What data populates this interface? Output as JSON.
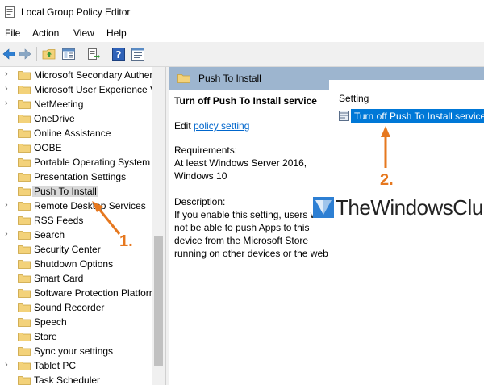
{
  "window": {
    "title": "Local Group Policy Editor"
  },
  "menu": [
    "File",
    "Action",
    "View",
    "Help"
  ],
  "tree": {
    "items": [
      {
        "label": "Microsoft Secondary Authen",
        "expandable": true
      },
      {
        "label": "Microsoft User Experience V",
        "expandable": true
      },
      {
        "label": "NetMeeting",
        "expandable": true
      },
      {
        "label": "OneDrive",
        "expandable": false
      },
      {
        "label": "Online Assistance",
        "expandable": false
      },
      {
        "label": "OOBE",
        "expandable": false
      },
      {
        "label": "Portable Operating System",
        "expandable": false
      },
      {
        "label": "Presentation Settings",
        "expandable": false
      },
      {
        "label": "Push To Install",
        "expandable": false,
        "selected": true
      },
      {
        "label": "Remote Desktop Services",
        "expandable": true
      },
      {
        "label": "RSS Feeds",
        "expandable": false
      },
      {
        "label": "Search",
        "expandable": true
      },
      {
        "label": "Security Center",
        "expandable": false
      },
      {
        "label": "Shutdown Options",
        "expandable": false
      },
      {
        "label": "Smart Card",
        "expandable": false
      },
      {
        "label": "Software Protection Platforn",
        "expandable": false
      },
      {
        "label": "Sound Recorder",
        "expandable": false
      },
      {
        "label": "Speech",
        "expandable": false
      },
      {
        "label": "Store",
        "expandable": false
      },
      {
        "label": "Sync your settings",
        "expandable": false
      },
      {
        "label": "Tablet PC",
        "expandable": true
      },
      {
        "label": "Task Scheduler",
        "expandable": false
      }
    ]
  },
  "panel": {
    "header": "Push To Install",
    "title": "Turn off Push To Install service",
    "edit_prefix": "Edit",
    "edit_link": "policy setting",
    "requirements_label": "Requirements:",
    "requirements_lines": [
      "At least Windows Server 2016,",
      "Windows 10"
    ],
    "description_label": "Description:",
    "description_lines": [
      "If you enable this setting, users w",
      "not be able to push Apps to this",
      "device from the Microsoft Store",
      "running on other devices or the web"
    ]
  },
  "list": {
    "column": "Setting",
    "row": "Turn off Push To Install service"
  },
  "watermark": {
    "text": "TheWindowsClub"
  },
  "annotations": {
    "step1": "1.",
    "step2": "2.",
    "color": "#e6781f"
  },
  "colors": {
    "header_bg": "#9db5cf",
    "selection_bg": "#0078d7",
    "folder": "#f3d27a",
    "toolbar_bg": "#f0f0f0"
  }
}
